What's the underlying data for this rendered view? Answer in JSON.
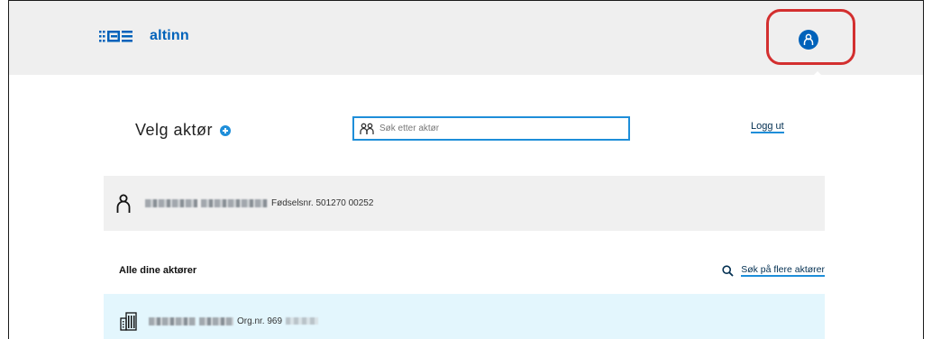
{
  "header": {
    "logo_text": "altinn"
  },
  "main": {
    "title": "Velg aktør",
    "search": {
      "placeholder": "Søk etter aktør",
      "value": ""
    },
    "logout_label": "Logg ut"
  },
  "self_actor": {
    "id_label": "Fødselsnr. 501270 00252"
  },
  "actors_section": {
    "title": "Alle dine aktører",
    "more_search_label": "Søk på flere aktører"
  },
  "org_actor": {
    "org_label": "Org.nr. 969"
  },
  "colors": {
    "brand": "#0062ba",
    "accent": "#1e8ed9",
    "highlight": "#d32f2f",
    "org_card_bg": "#e3f6fd",
    "header_bg": "#efefef"
  },
  "icons": [
    "altinn-logo-icon",
    "user-profile-icon",
    "add-circle-icon",
    "people-icon",
    "person-icon",
    "magnifier-icon",
    "building-icon"
  ]
}
